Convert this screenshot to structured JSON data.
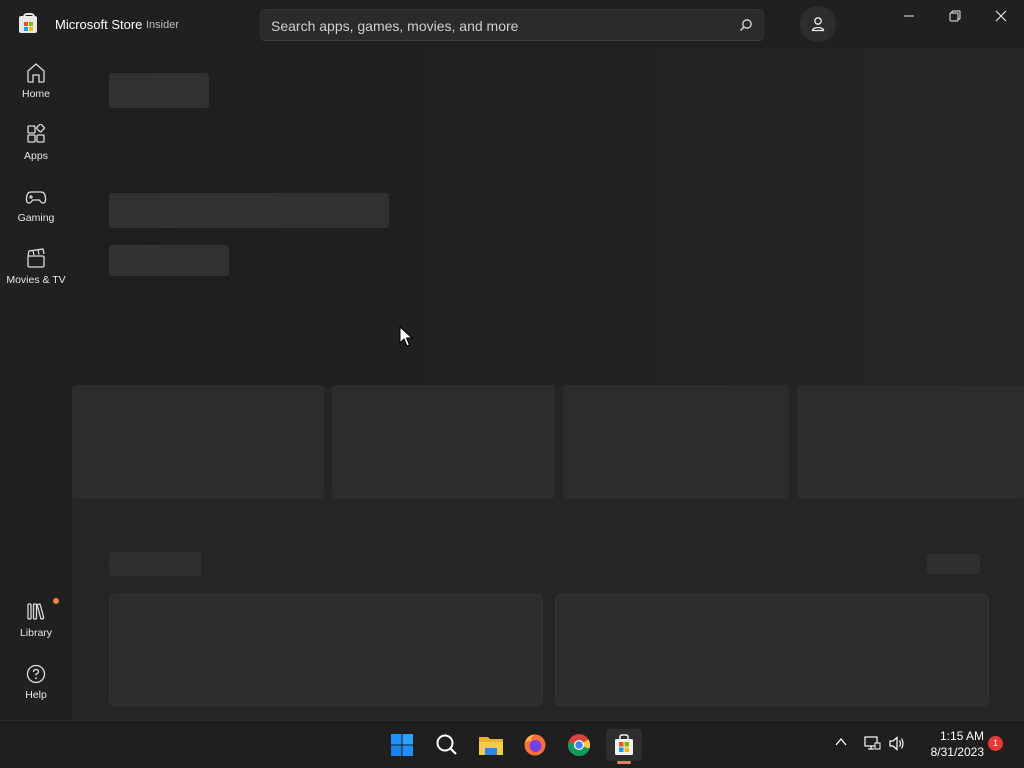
{
  "window": {
    "title": "Microsoft Store",
    "badge": "Insider"
  },
  "search": {
    "placeholder": "Search apps, games, movies, and more"
  },
  "sidebar": {
    "items": [
      {
        "label": "Home",
        "icon": "home-icon"
      },
      {
        "label": "Apps",
        "icon": "apps-icon"
      },
      {
        "label": "Gaming",
        "icon": "gaming-icon"
      },
      {
        "label": "Movies & TV",
        "icon": "movies-tv-icon"
      }
    ],
    "bottom": [
      {
        "label": "Library",
        "icon": "library-icon",
        "has_dot": true
      },
      {
        "label": "Help",
        "icon": "help-icon"
      }
    ]
  },
  "taskbar": {
    "apps": [
      "start",
      "search",
      "file-explorer",
      "firefox",
      "chrome",
      "microsoft-store"
    ],
    "active": "microsoft-store",
    "time": "1:15 AM",
    "date": "8/31/2023",
    "notification_count": "1"
  },
  "colors": {
    "accent_dot": "#e8824a",
    "notification": "#e53935"
  }
}
